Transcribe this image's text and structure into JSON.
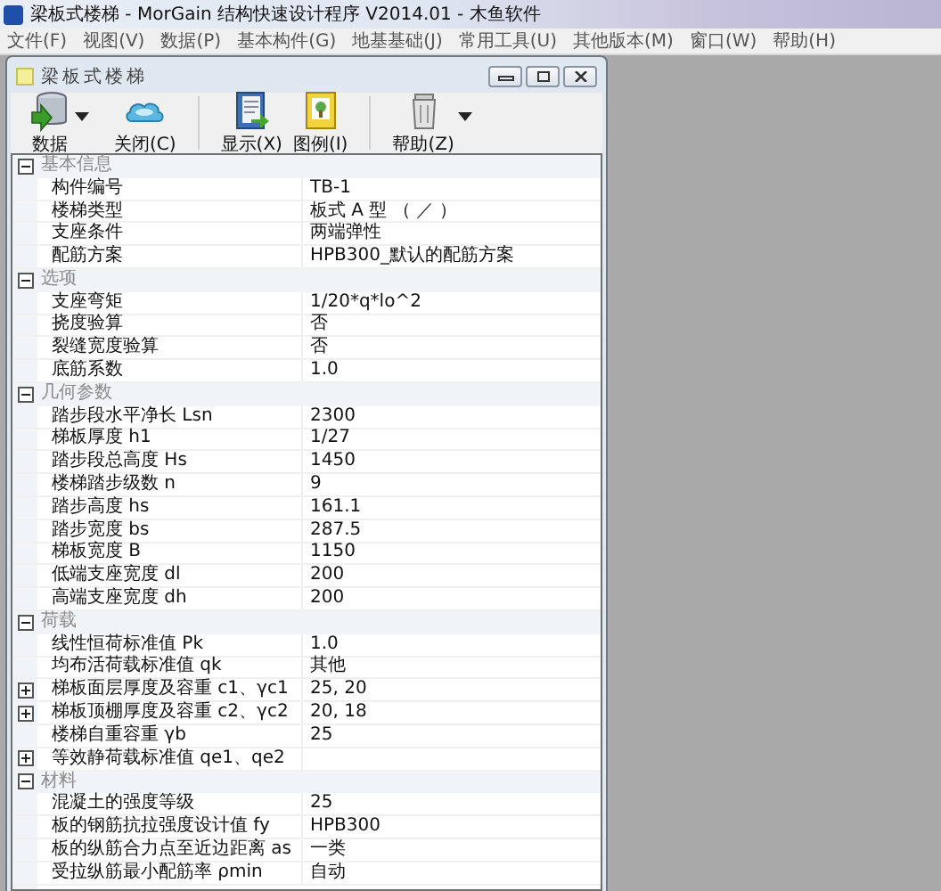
{
  "window": {
    "title": "梁板式楼梯 - MorGain 结构快速设计程序 V2014.01 - 木鱼软件"
  },
  "menu": [
    "文件(F)",
    "视图(V)",
    "数据(P)",
    "基本构件(G)",
    "地基基础(J)",
    "常用工具(U)",
    "其他版本(M)",
    "窗口(W)",
    "帮助(H)"
  ],
  "document": {
    "title": "梁板式楼梯",
    "toolbar": [
      {
        "label": "数据",
        "dropdown": true
      },
      {
        "label": "关闭(C)",
        "dropdown": false
      },
      {
        "label": "显示(X)",
        "dropdown": false,
        "separator_before": true
      },
      {
        "label": "图例(I)",
        "dropdown": false
      },
      {
        "label": "帮助(Z)",
        "dropdown": true,
        "separator_before": true
      }
    ],
    "sections": [
      {
        "title": "基本信息",
        "expanded": true,
        "rows": [
          {
            "kind": "plain",
            "name": "构件编号",
            "value": "TB-1"
          },
          {
            "kind": "plain",
            "name": "楼梯类型",
            "value": "板式 A 型 （ ／ ）"
          },
          {
            "kind": "plain",
            "name": "支座条件",
            "value": "两端弹性"
          },
          {
            "kind": "plain",
            "name": "配筋方案",
            "value": "HPB300_默认的配筋方案"
          }
        ]
      },
      {
        "title": "选项",
        "expanded": true,
        "rows": [
          {
            "kind": "plain",
            "name": "支座弯矩",
            "value": "1/20*q*lo^2"
          },
          {
            "kind": "plain",
            "name": "挠度验算",
            "value": "否"
          },
          {
            "kind": "plain",
            "name": "裂缝宽度验算",
            "value": "否"
          },
          {
            "kind": "plain",
            "name": "底筋系数",
            "value": "1.0"
          }
        ]
      },
      {
        "title": "几何参数",
        "expanded": true,
        "rows": [
          {
            "kind": "plain",
            "name": "踏步段水平净长 Lsn",
            "value": "2300"
          },
          {
            "kind": "plain",
            "name": "梯板厚度 h1",
            "value": "1/27"
          },
          {
            "kind": "plain",
            "name": "踏步段总高度 Hs",
            "value": "1450"
          },
          {
            "kind": "plain",
            "name": "楼梯踏步级数 n",
            "value": "9"
          },
          {
            "kind": "plain",
            "name": "踏步高度 hs",
            "value": "161.1"
          },
          {
            "kind": "plain",
            "name": "踏步宽度 bs",
            "value": "287.5"
          },
          {
            "kind": "plain",
            "name": "梯板宽度 B",
            "value": "1150"
          },
          {
            "kind": "plain",
            "name": "低端支座宽度 dl",
            "value": "200"
          },
          {
            "kind": "plain",
            "name": "高端支座宽度 dh",
            "value": "200"
          }
        ]
      },
      {
        "title": "荷载",
        "expanded": true,
        "rows": [
          {
            "kind": "plain",
            "name": "线性恒荷标准值 Pk",
            "value": "1.0"
          },
          {
            "kind": "plain",
            "name": "均布活荷载标准值 qk",
            "value": "其他"
          },
          {
            "kind": "group",
            "expanded": false,
            "name": "梯板面层厚度及容重 c1、γc1",
            "value": "25, 20"
          },
          {
            "kind": "group",
            "expanded": false,
            "name": "梯板顶棚厚度及容重 c2、γc2",
            "value": "20, 18"
          },
          {
            "kind": "plain",
            "name": "楼梯自重容重 γb",
            "value": "25"
          },
          {
            "kind": "group",
            "expanded": false,
            "name": "等效静荷载标准值 qe1、qe2"
          }
        ]
      },
      {
        "title": "材料",
        "expanded": true,
        "rows": [
          {
            "kind": "plain",
            "name": "混凝土的强度等级",
            "value": "25"
          },
          {
            "kind": "plain",
            "name": "板的钢筋抗拉强度设计值 fy",
            "value": "HPB300"
          },
          {
            "kind": "plain",
            "name": "板的纵筋合力点至近边距离 as",
            "value": "一类"
          },
          {
            "kind": "plain",
            "name": "受拉纵筋最小配筋率 ρmin",
            "value": "自动"
          }
        ]
      }
    ]
  }
}
